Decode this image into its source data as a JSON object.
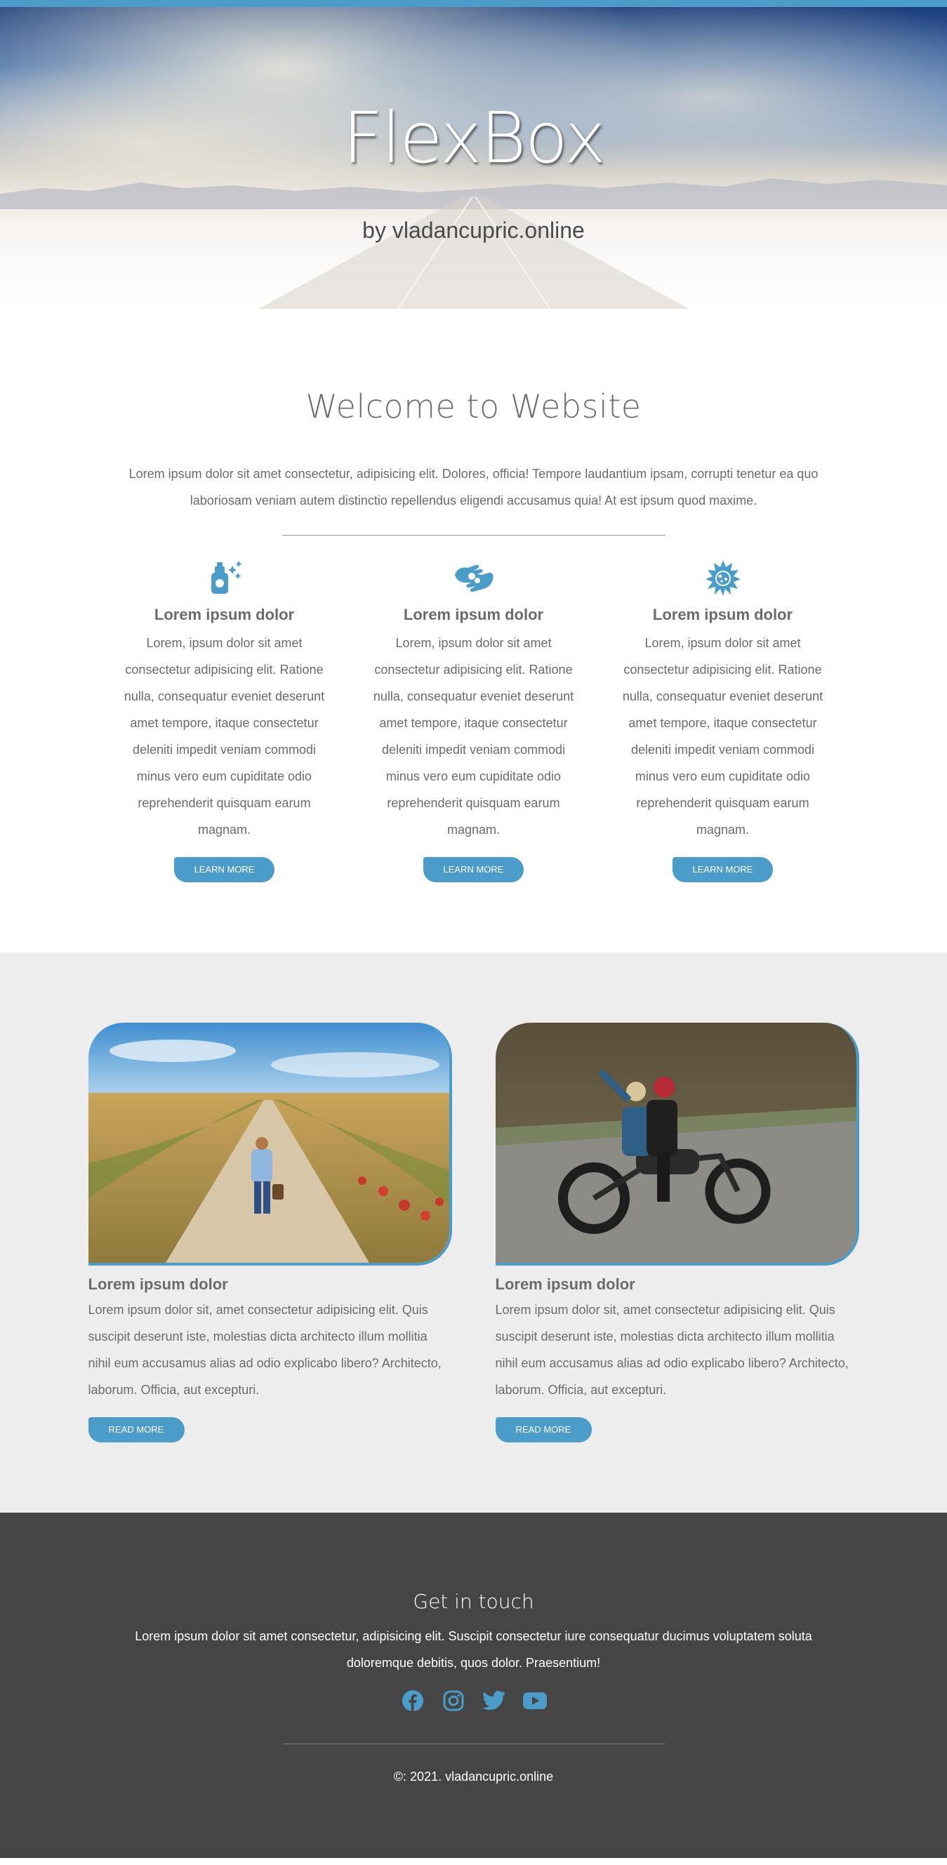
{
  "hero": {
    "title": "FlexBox",
    "subtitle": "by vladancupric.online"
  },
  "welcome": {
    "title": "Welcome to Website",
    "text": "Lorem ipsum dolor sit amet consectetur, adipisicing elit. Dolores, officia! Tempore laudantium ipsam, corrupti tenetur ea quo laboriosam veniam autem distinctio repellendus eligendi accusamus quia! At est ipsum quod maxime."
  },
  "features": [
    {
      "icon": "spray-bottle-icon",
      "title": "Lorem ipsum dolor",
      "text": "Lorem, ipsum dolor sit amet consectetur adipisicing elit. Ratione nulla, consequatur eveniet deserunt amet tempore, itaque consectetur deleniti impedit veniam commodi minus vero eum cupiditate odio reprehenderit quisquam earum magnam.",
      "button": "Learn more"
    },
    {
      "icon": "sign-language-icon",
      "title": "Lorem ipsum dolor",
      "text": "Lorem, ipsum dolor sit amet consectetur adipisicing elit. Ratione nulla, consequatur eveniet deserunt amet tempore, itaque consectetur deleniti impedit veniam commodi minus vero eum cupiditate odio reprehenderit quisquam earum magnam.",
      "button": "Learn more"
    },
    {
      "icon": "virus-icon",
      "title": "Lorem ipsum dolor",
      "text": "Lorem, ipsum dolor sit amet consectetur adipisicing elit. Ratione nulla, consequatur eveniet deserunt amet tempore, itaque consectetur deleniti impedit veniam commodi minus vero eum cupiditate odio reprehenderit quisquam earum magnam.",
      "button": "Learn more"
    }
  ],
  "cards": [
    {
      "image": "woman-walking-dirt-road-photo",
      "title": "Lorem ipsum dolor",
      "text": "Lorem ipsum dolor sit, amet consectetur adipisicing elit. Quis suscipit deserunt iste, molestias dicta architecto illum mollitia nihil eum accusamus alias ad odio explicabo libero? Architecto, laborum. Officia, aut excepturi.",
      "button": "Read more"
    },
    {
      "image": "couple-on-motorcycle-photo",
      "title": "Lorem ipsum dolor",
      "text": "Lorem ipsum dolor sit, amet consectetur adipisicing elit. Quis suscipit deserunt iste, molestias dicta architecto illum mollitia nihil eum accusamus alias ad odio explicabo libero? Architecto, laborum. Officia, aut excepturi.",
      "button": "Read more"
    }
  ],
  "footer": {
    "title": "Get in touch",
    "text": "Lorem ipsum dolor sit amet consectetur, adipisicing elit. Suscipit consectetur iure consequatur ducimus voluptatem soluta doloremque debitis, quos dolor. Praesentium!",
    "socials": [
      "facebook-icon",
      "instagram-icon",
      "twitter-icon",
      "youtube-icon"
    ],
    "copyright": "©: 2021. vladancupric.online"
  },
  "colors": {
    "accent": "#4b9cc8",
    "footer_bg": "#454545",
    "cards_bg": "#ededed",
    "text": "#6b6b6b"
  }
}
